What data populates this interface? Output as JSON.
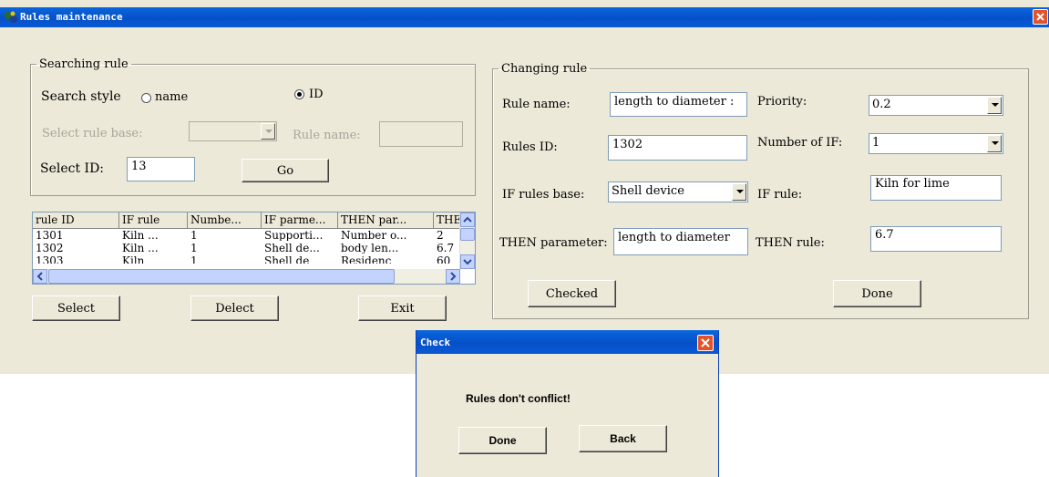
{
  "window": {
    "title": "Rules maintenance"
  },
  "search_group": {
    "legend": "Searching rule",
    "search_style_label": "Search style",
    "option_name": "name",
    "option_id": "ID",
    "selected_option": "ID",
    "rule_base_label": "Select rule base:",
    "rule_base_value": "",
    "rule_name_label": "Rule name:",
    "rule_name_value": "",
    "select_id_label": "Select ID:",
    "select_id_value": "13",
    "go_label": "Go"
  },
  "grid": {
    "columns": [
      "rule ID",
      "IF rule",
      "Numbe...",
      "IF parme...",
      "THEN par...",
      "THE"
    ],
    "rows": [
      [
        "1301",
        "Kiln ...",
        "1",
        "Supporti...",
        "Number o...",
        "2"
      ],
      [
        "1302",
        "Kiln ...",
        "1",
        "Shell de...",
        "body len...",
        "6.7"
      ],
      [
        "1303",
        "Kiln",
        "1",
        "Shell de",
        "Residenc",
        "60"
      ]
    ]
  },
  "bottom_buttons": {
    "select": "Select",
    "delect": "Delect",
    "exit": "Exit"
  },
  "change_group": {
    "legend": "Changing rule",
    "rule_name_label": "Rule name:",
    "rule_name_value": "length to diameter :",
    "priority_label": "Priority:",
    "priority_value": "0.2",
    "rules_id_label": "Rules ID:",
    "rules_id_value": "1302",
    "number_if_label": "Number of IF:",
    "number_if_value": "1",
    "if_base_label": "IF rules base:",
    "if_base_value": "Shell device",
    "if_rule_label": "IF rule:",
    "if_rule_value": "Kiln for lime",
    "then_param_label": "THEN parameter:",
    "then_param_value": "length to diameter",
    "then_rule_label": "THEN rule:",
    "then_rule_value": "6.7",
    "checked_label": "Checked",
    "done_label": "Done"
  },
  "dialog": {
    "title": "Check",
    "message": "Rules don't conflict!",
    "done_label": "Done",
    "back_label": "Back"
  },
  "colors": {
    "title_bar": "#0550c8",
    "window_bg": "#ece9d8",
    "close_button": "#e3532b"
  }
}
